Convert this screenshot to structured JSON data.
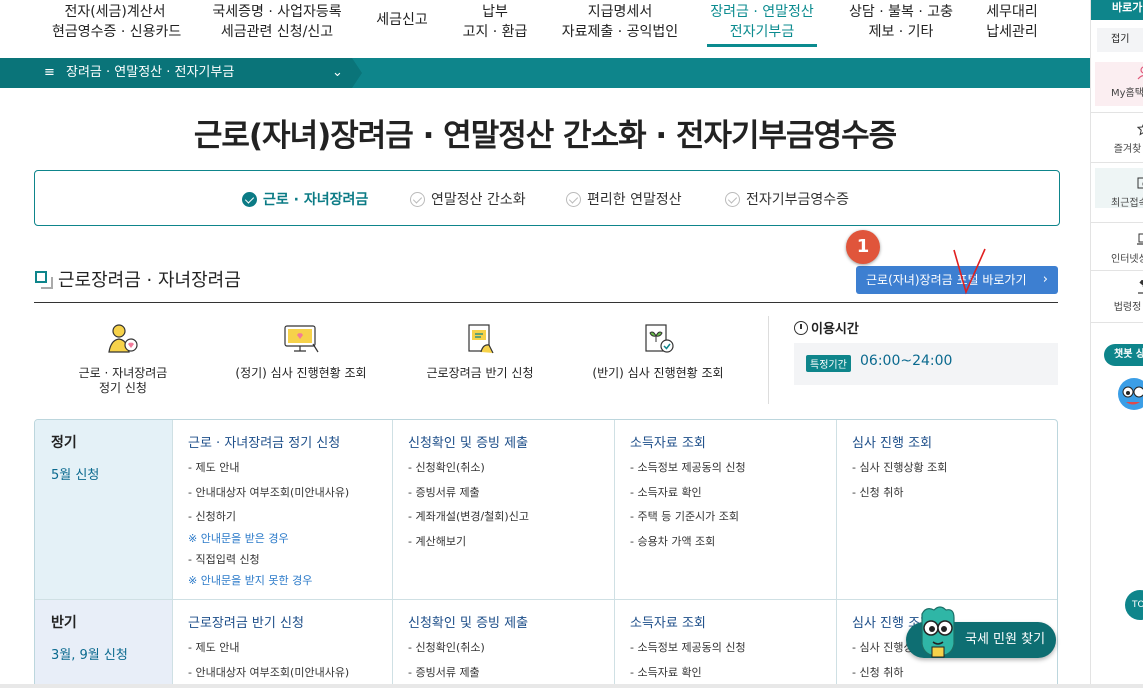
{
  "nav": [
    {
      "l1": "전자(세금)계산서",
      "l2": "현금영수증 · 신용카드"
    },
    {
      "l1": "국세증명 · 사업자등록",
      "l2": "세금관련 신청/신고"
    },
    {
      "l1": "세금신고",
      "l2": ""
    },
    {
      "l1": "납부",
      "l2": "고지 · 환급"
    },
    {
      "l1": "지급명세서",
      "l2": "자료제출 · 공익법인"
    },
    {
      "l1": "장려금 · 연말정산",
      "l2": "전자기부금"
    },
    {
      "l1": "상담 · 불복 · 고충",
      "l2": "제보 · 기타"
    },
    {
      "l1": "세무대리",
      "l2": "납세관리"
    }
  ],
  "breadcrumb": {
    "menu_icon": "≡",
    "label": "장려금 · 연말정산 · 전자기부금",
    "chevron": "⌄"
  },
  "page_title": "근로(자녀)장려금 · 연말정산 간소화 · 전자기부금영수증",
  "tabs": [
    {
      "label": "근로 · 자녀장려금",
      "active": true
    },
    {
      "label": "연말정산 간소화",
      "active": false
    },
    {
      "label": "편리한 연말정산",
      "active": false
    },
    {
      "label": "전자기부금영수증",
      "active": false
    }
  ],
  "section": {
    "title": "근로장려금 · 자녀장려금",
    "badge": "1",
    "portal_button": "근로(자녀)장려금 포털 바로가기",
    "portal_arrow": "›"
  },
  "quick_links": [
    {
      "l1": "근로 · 자녀장려금",
      "l2": "정기 신청",
      "icon": "person-heart-icon"
    },
    {
      "l1": "(정기) 심사 진행현황 조회",
      "l2": "",
      "icon": "monitor-heart-icon"
    },
    {
      "l1": "근로장려금 반기 신청",
      "l2": "",
      "icon": "document-hand-icon"
    },
    {
      "l1": "(반기) 심사 진행현황 조회",
      "l2": "",
      "icon": "document-check-icon"
    }
  ],
  "hours": {
    "title": "이용시간",
    "tag": "특정기간",
    "value": "06:00~24:00"
  },
  "rows": [
    {
      "title": "정기",
      "sub": "5월 신청",
      "cols": [
        {
          "head": "근로 · 자녀장려금 정기 신청",
          "items": [
            {
              "t": "- 제도 안내",
              "note": false
            },
            {
              "t": "- 안내대상자 여부조회(미안내사유)",
              "note": false
            },
            {
              "t": "- 신청하기",
              "note": false
            },
            {
              "t": "※ 안내문을 받은 경우",
              "note": true
            },
            {
              "t": "- 직접입력 신청",
              "note": false
            },
            {
              "t": "※ 안내문을 받지 못한 경우",
              "note": true
            }
          ]
        },
        {
          "head": "신청확인 및 증빙 제출",
          "items": [
            {
              "t": "- 신청확인(취소)",
              "note": false
            },
            {
              "t": "- 증빙서류 제출",
              "note": false
            },
            {
              "t": "- 계좌개설(변경/철회)신고",
              "note": false
            },
            {
              "t": "- 계산해보기",
              "note": false
            }
          ]
        },
        {
          "head": "소득자료 조회",
          "items": [
            {
              "t": "- 소득정보 제공동의 신청",
              "note": false
            },
            {
              "t": "- 소득자료 확인",
              "note": false
            },
            {
              "t": "- 주택 등 기준시가 조회",
              "note": false
            },
            {
              "t": "- 승용차 가액 조회",
              "note": false
            }
          ]
        },
        {
          "head": "심사 진행 조회",
          "items": [
            {
              "t": "- 심사 진행상황 조회",
              "note": false
            },
            {
              "t": "- 신청 취하",
              "note": false
            }
          ]
        }
      ]
    },
    {
      "title": "반기",
      "sub": "3월, 9월 신청",
      "cols": [
        {
          "head": "근로장려금 반기 신청",
          "items": [
            {
              "t": "- 제도 안내",
              "note": false
            },
            {
              "t": "- 안내대상자 여부조회(미안내사유)",
              "note": false
            }
          ]
        },
        {
          "head": "신청확인 및 증빙 제출",
          "items": [
            {
              "t": "- 신청확인(취소)",
              "note": false
            },
            {
              "t": "- 증빙서류 제출",
              "note": false
            }
          ]
        },
        {
          "head": "소득자료 조회",
          "items": [
            {
              "t": "- 소득정보 제공동의 신청",
              "note": false
            },
            {
              "t": "- 소득자료 확인",
              "note": false
            }
          ]
        },
        {
          "head": "심사 진행 조회",
          "items": [
            {
              "t": "- 심사 진행상황 조회",
              "note": false
            },
            {
              "t": "- 신청 취하",
              "note": false
            }
          ]
        }
      ]
    }
  ],
  "rail": {
    "top": "바로가",
    "fold": "접기",
    "items": [
      "My홈택",
      "즐겨찾",
      "최근접속",
      "인터넷상",
      "법령정"
    ],
    "chatbot": "챗봇 상",
    "top_btn": "TO"
  },
  "find_button": "국세 민원 찾기",
  "colors": {
    "teal": "#0e858b",
    "dark_teal": "#0a7479",
    "blue_btn": "#3d7fd1",
    "badge": "#e0553b",
    "head_blue": "#1d4e89"
  }
}
